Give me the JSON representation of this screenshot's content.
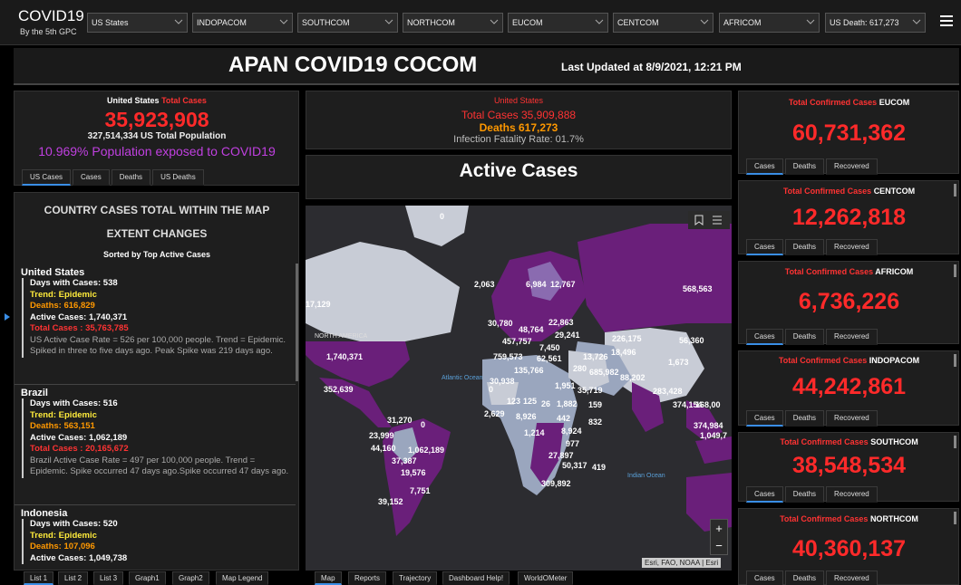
{
  "header": {
    "title": "COVID19",
    "subtitle": "By the 5th GPC",
    "filters": [
      "US States",
      "INDOPACOM",
      "SOUTHCOM",
      "NORTHCOM",
      "EUCOM",
      "CENTCOM",
      "AFRICOM",
      "US Death: 617,273"
    ]
  },
  "banner": {
    "title": "APAN COVID19 COCOM",
    "updated": "Last Updated at 8/9/2021, 12:21 PM"
  },
  "us_panel": {
    "label_white": "United States",
    "label_red": "Total Cases",
    "total": "35,923,908",
    "population": "327,514,334 US Total Population",
    "percent": "10.969% Population exposed to COVID19",
    "tabs": [
      "US Cases",
      "Cases",
      "Deaths",
      "US Deaths"
    ]
  },
  "country_list": {
    "heading1": "COUNTRY CASES TOTAL WITHIN THE MAP",
    "heading2": "EXTENT CHANGES",
    "sorted": "Sorted by Top Active Cases",
    "items": [
      {
        "name": "United States",
        "days": "Days with Cases: 538",
        "trend": "Trend: Epidemic",
        "deaths": "Deaths: 616,829",
        "active": "Active Cases: 1,740,371",
        "total": "Total Cases : 35,763,785",
        "note": "US Active Case Rate = 526 per 100,000 people. Trend = Epidemic. Spiked in three to five days ago. Peak Spike was 219 days ago."
      },
      {
        "name": "Brazil",
        "days": "Days with Cases: 516",
        "trend": "Trend: Epidemic",
        "deaths": "Deaths: 563,151",
        "active": "Active Cases: 1,062,189",
        "total": "Total Cases : 20,165,672",
        "note": "Brazil Active Case Rate = 497 per 100,000 people. Trend = Epidemic. Spike occurred 47 days ago.Spike occurred 47 days ago."
      },
      {
        "name": "Indonesia",
        "days": "Days with Cases: 520",
        "trend": "Trend: Epidemic",
        "deaths": "Deaths: 107,096",
        "active": "Active Cases: 1,049,738"
      }
    ]
  },
  "center": {
    "label": "United States",
    "total": "Total Cases 35,909,888",
    "deaths": "Deaths 617,273",
    "ifr": "Infection Fatality Rate: 01.7%",
    "active_title": "Active Cases"
  },
  "map": {
    "labels": [
      "0",
      "17,129",
      "2,063",
      "6,984",
      "12,767",
      "568,563",
      "30,780",
      "48,764",
      "22,863",
      "457,757",
      "29,241",
      "7,450",
      "226,175",
      "56,360",
      "1,740,371",
      "759,573",
      "62,561",
      "18,496",
      "1,673",
      "135,766",
      "13,726",
      "685,982",
      "30,938",
      "280",
      "88,202",
      "352,639",
      "0",
      "1,951",
      "35,719",
      "283,428",
      "123",
      "125",
      "26",
      "1,882",
      "159",
      "374,154",
      "168,00",
      "2,629",
      "8,926",
      "442",
      "832",
      "31,270",
      "0",
      "1,214",
      "8,924",
      "374,984",
      "1,049,7",
      "23,999",
      "977",
      "44,160",
      "1,062,189",
      "27,897",
      "37,387",
      "50,317",
      "419",
      "19,576",
      "309,892",
      "7,751",
      "39,152"
    ],
    "ocean_atlantic": "Atlantic Ocean",
    "ocean_indian": "Indian Ocean",
    "region_north_america": "NORTH AMERICA",
    "attribution": "Esri, FAO, NOAA | Esri",
    "zoom_in": "+",
    "zoom_out": "−"
  },
  "right_panels": [
    {
      "label_red": "Total Confirmed Cases",
      "label_white": "EUCOM",
      "value": "60,731,362"
    },
    {
      "label_red": "Total Confirmed Cases",
      "label_white": "CENTCOM",
      "value": "12,262,818"
    },
    {
      "label_red": "Total Confirmed Cases",
      "label_white": "AFRICOM",
      "value": "6,736,226"
    },
    {
      "label_red": "Total Confirmed Cases",
      "label_white": "INDOPACOM",
      "value": "44,242,861"
    },
    {
      "label_red": "Total Confirmed Cases",
      "label_white": "SOUTHCOM",
      "value": "38,548,534"
    },
    {
      "label_red": "Total Confirmed Cases",
      "label_white": "NORTHCOM",
      "value": "40,360,137"
    }
  ],
  "right_tabs": [
    "Cases",
    "Deaths",
    "Recovered"
  ],
  "bottom_left_tabs": [
    "List 1",
    "List 2",
    "List 3",
    "Graph1",
    "Graph2",
    "Map Legend"
  ],
  "bottom_center_tabs": [
    "Map",
    "Reports",
    "Trajectory",
    "Dashboard Help!",
    "WorldOMeter"
  ],
  "colors": {
    "accent_blue": "#3a8ee6",
    "case_red": "#ff2a2a",
    "death_orange": "#ff9800",
    "trend_yellow": "#ffeb3b",
    "exposed_purple": "#c040e0",
    "map_purple": "#6a1f7a"
  }
}
